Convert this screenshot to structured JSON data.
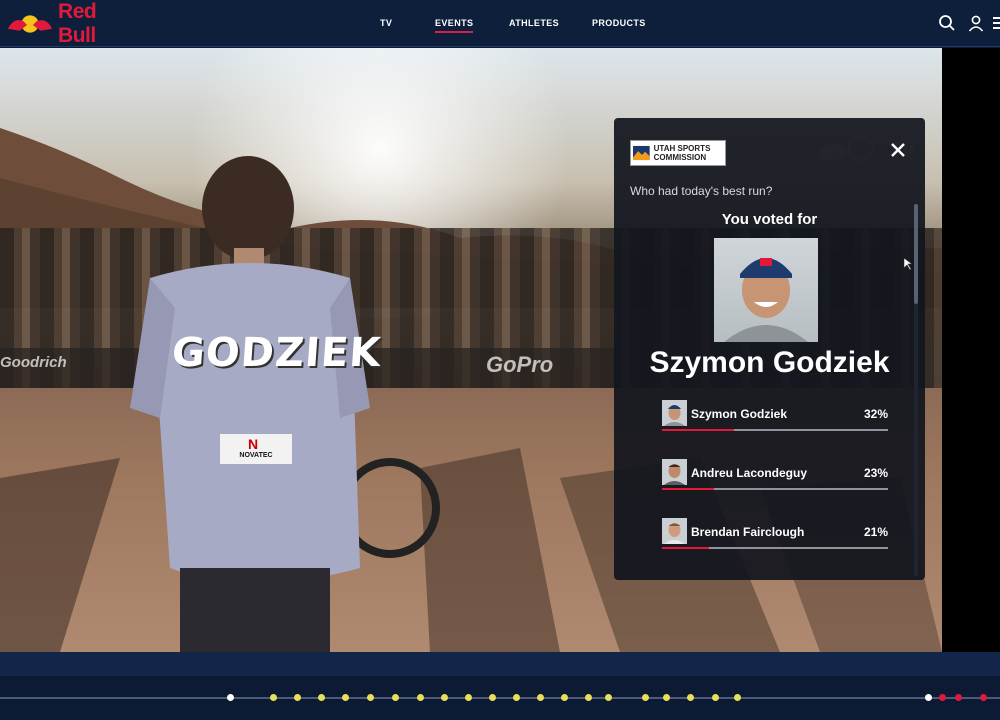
{
  "nav": {
    "brand": "Red Bull",
    "items": [
      {
        "label": "TV",
        "active": false
      },
      {
        "label": "EVENTS",
        "active": true
      },
      {
        "label": "ATHLETES",
        "active": false
      },
      {
        "label": "PRODUCTS",
        "active": false
      }
    ],
    "icons": [
      "search-icon",
      "user-icon",
      "menu-icon"
    ]
  },
  "video": {
    "jersey_name": "GODZIEK",
    "jersey_sponsor": "NOVATEC",
    "banner_left": "Goodrich",
    "banner_center": "GoPro",
    "watermark": "TV"
  },
  "poll": {
    "sponsor": "UTAH SPORTS COMMISSION",
    "question": "Who had today's best run?",
    "voted_label": "You voted for",
    "voted_name": "Szymon Godziek",
    "results": [
      {
        "name": "Szymon Godziek",
        "percent": "32%",
        "value": 32
      },
      {
        "name": "Andreu Lacondeguy",
        "percent": "23%",
        "value": 23
      },
      {
        "name": "Brendan Fairclough",
        "percent": "21%",
        "value": 21
      }
    ]
  },
  "timeline": {
    "markers": [
      {
        "color": "#ffffff"
      },
      {
        "color": "#e8e05a"
      },
      {
        "color": "#e8e05a"
      },
      {
        "color": "#e8e05a"
      },
      {
        "color": "#e8e05a"
      },
      {
        "color": "#e8e05a"
      },
      {
        "color": "#e8e05a"
      },
      {
        "color": "#e8e05a"
      },
      {
        "color": "#e8e05a"
      },
      {
        "color": "#e8e05a"
      },
      {
        "color": "#e8e05a"
      },
      {
        "color": "#e8e05a"
      },
      {
        "color": "#e8e05a"
      },
      {
        "color": "#e8e05a"
      },
      {
        "color": "#e8e05a"
      },
      {
        "color": "#e8e05a"
      },
      {
        "color": "#e8e05a"
      },
      {
        "color": "#e8e05a"
      },
      {
        "color": "#e8e05a"
      },
      {
        "color": "#e8e05a"
      },
      {
        "color": "#e8e05a"
      },
      {
        "color": "#ffffff"
      },
      {
        "color": "#e11a3c"
      },
      {
        "color": "#e11a3c"
      },
      {
        "color": "#e11a3c"
      }
    ]
  },
  "colors": {
    "accent": "#e11a3c",
    "nav_bg": "#0e1f3c",
    "marker_yellow": "#e8e05a"
  }
}
